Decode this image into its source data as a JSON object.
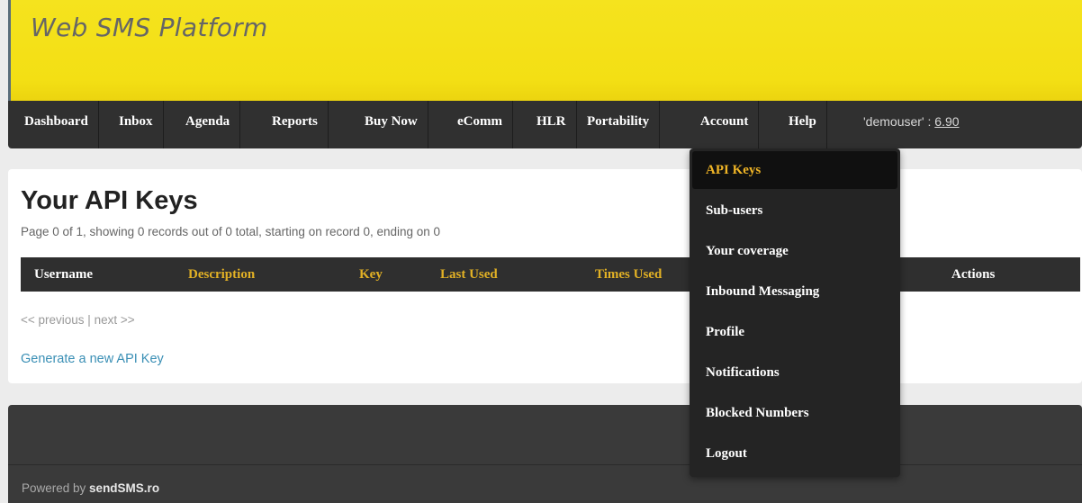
{
  "header": {
    "title": "Web SMS Platform"
  },
  "nav": {
    "items": [
      "Dashboard",
      "Inbox",
      "Agenda",
      "Reports",
      "Buy Now",
      "eComm",
      "HLR",
      "Portability",
      "Account",
      "Help"
    ],
    "user_label": "'demouser' : ",
    "balance": "6.90"
  },
  "main": {
    "title": "Your API Keys",
    "page_info": "Page 0 of 1, showing 0 records out of 0 total, starting on record 0, ending on 0",
    "columns": [
      "Username",
      "Description",
      "Key",
      "Last Used",
      "Times Used",
      "Actions"
    ],
    "pager": {
      "previous": "<< previous",
      "separator": " | ",
      "next": "next >>"
    },
    "generate_link": "Generate a new API Key"
  },
  "dropdown": {
    "items": [
      "API Keys",
      "Sub-users",
      "Your coverage",
      "Inbound Messaging",
      "Profile",
      "Notifications",
      "Blocked Numbers",
      "Logout"
    ]
  },
  "footer": {
    "powered_prefix": "Powered by ",
    "powered_brand": "sendSMS.ro"
  },
  "colors": {
    "header_yellow": "#f3df14",
    "nav_dark": "#303030",
    "accent_gold": "#e2b125",
    "link_blue": "#3a8fb5"
  }
}
